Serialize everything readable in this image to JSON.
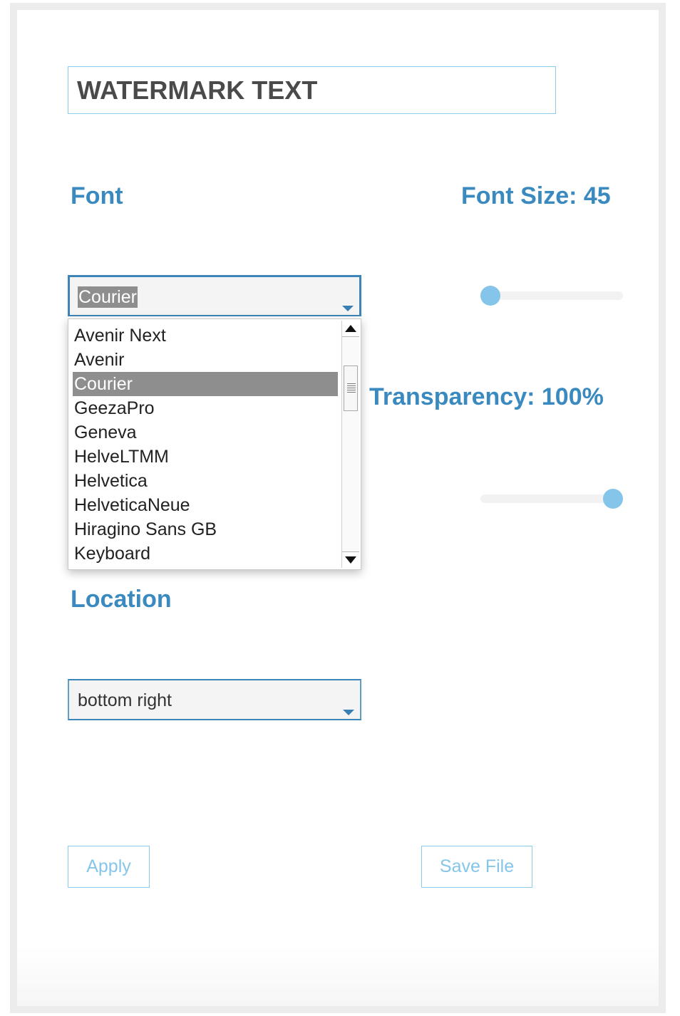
{
  "watermark": {
    "value": "WATERMARK TEXT"
  },
  "font": {
    "label": "Font",
    "selected": "Courier",
    "options": [
      "Avenir Next",
      "Avenir",
      "Courier",
      "GeezaPro",
      "Geneva",
      "HelveLTMM",
      "Helvetica",
      "HelveticaNeue",
      "Hiragino Sans GB",
      "Keyboard"
    ],
    "selected_index": 2
  },
  "font_size": {
    "label": "Font Size: 45",
    "value": 45,
    "slider_fraction": 0.07
  },
  "transparency": {
    "label": "Transparency: 100%",
    "value_percent": 100,
    "slider_fraction": 0.93
  },
  "location": {
    "label": "Location",
    "selected": "bottom right"
  },
  "buttons": {
    "apply": "Apply",
    "save": "Save File"
  },
  "colors": {
    "accent": "#3a8abf",
    "slider_thumb": "#86c5ea",
    "button_text": "#86c5ea",
    "select_highlight": "#8e8e8e"
  },
  "icons": {
    "dropdown_caret": "chevron-down-icon",
    "scroll_up": "arrow-up-icon",
    "scroll_down": "arrow-down-icon"
  }
}
